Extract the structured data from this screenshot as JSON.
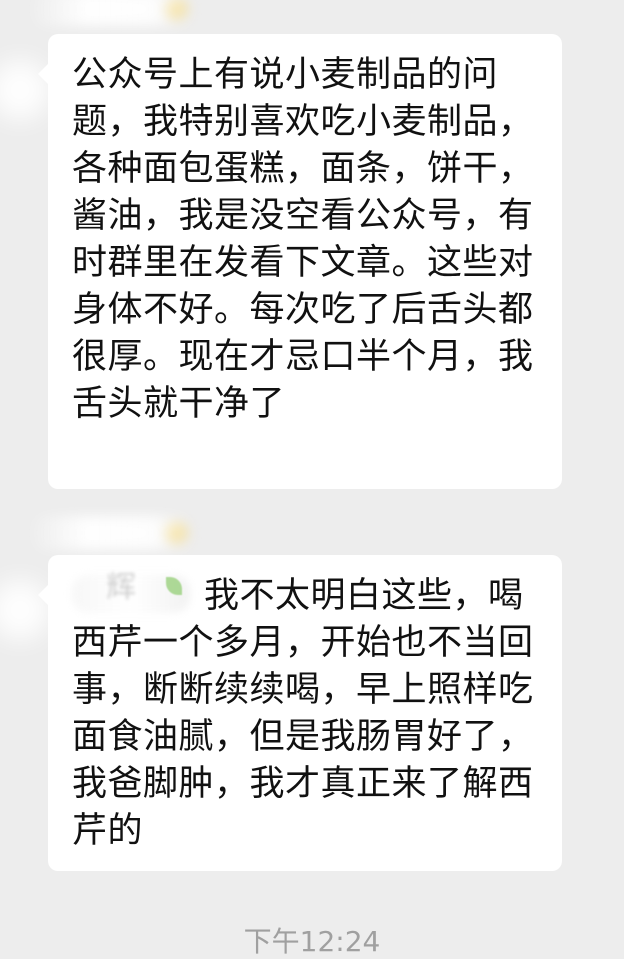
{
  "messages": [
    {
      "text": "公众号上有说小麦制品的问题，我特别喜欢吃小麦制品，各种面包蛋糕，面条，饼干，酱油，我是没空看公众号，有时群里在发看下文章。这些对身体不好。每次吃了后舌头都很厚。现在才忌口半个月，我舌头就干净了"
    },
    {
      "mention_text": "辉",
      "text": "我不太明白这些，喝西芹一个多月，开始也不当回事，断断续续喝，早上照样吃面食油腻，但是我肠胃好了，我爸脚肿，我才真正来了解西芹的"
    }
  ],
  "timestamp": "下午12:24",
  "colors": {
    "background": "#ededed",
    "bubble": "#ffffff",
    "text": "#111111",
    "timestamp": "#a0a0a0"
  }
}
